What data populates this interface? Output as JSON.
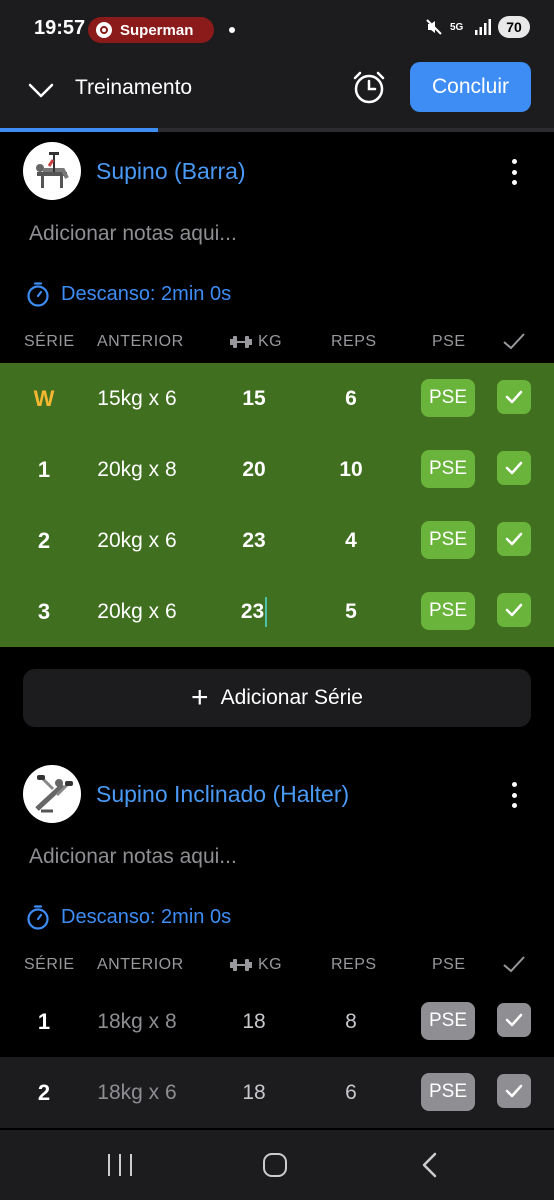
{
  "status_bar": {
    "time": "19:57",
    "notification_app": "Superman",
    "network": "5G",
    "battery": "70"
  },
  "header": {
    "title": "Treinamento",
    "finish_label": "Concluir",
    "progress_fraction": 0.285,
    "accent_color": "#3d8df5"
  },
  "table_headers": {
    "set": "SÉRIE",
    "previous": "ANTERIOR",
    "kg": "KG",
    "reps": "REPS",
    "rpe": "PSE"
  },
  "exercises": [
    {
      "name": "Supino (Barra)",
      "notes_placeholder": "Adicionar notas aqui...",
      "rest": "Descanso: 2min 0s",
      "sets": [
        {
          "set": "W",
          "previous": "15kg x 6",
          "kg": "15",
          "reps": "6",
          "rpe": "PSE",
          "completed": true
        },
        {
          "set": "1",
          "previous": "20kg x 8",
          "kg": "20",
          "reps": "10",
          "rpe": "PSE",
          "completed": true
        },
        {
          "set": "2",
          "previous": "20kg x 6",
          "kg": "23",
          "reps": "4",
          "rpe": "PSE",
          "completed": true
        },
        {
          "set": "3",
          "previous": "20kg x 6",
          "kg": "23",
          "reps": "5",
          "rpe": "PSE",
          "completed": true
        }
      ],
      "add_set_label": "Adicionar Série"
    },
    {
      "name": "Supino Inclinado (Halter)",
      "notes_placeholder": "Adicionar notas aqui...",
      "rest": "Descanso: 2min 0s",
      "sets": [
        {
          "set": "1",
          "previous": "18kg x 8",
          "kg": "18",
          "reps": "8",
          "rpe": "PSE",
          "completed": false
        },
        {
          "set": "2",
          "previous": "18kg x 6",
          "kg": "18",
          "reps": "6",
          "rpe": "PSE",
          "completed": false
        }
      ]
    }
  ],
  "colors": {
    "completed_row": "#3f6f1f",
    "completed_badge": "#6ab43c",
    "warmup": "#f4b731",
    "pending_badge": "#8e8e93"
  },
  "icons": {
    "collapse": "chevron-down-icon",
    "timer": "alarm-clock-icon",
    "rest": "stopwatch-icon",
    "weight": "dumbbell-icon",
    "check": "checkmark-icon",
    "menu": "more-vertical-icon"
  }
}
